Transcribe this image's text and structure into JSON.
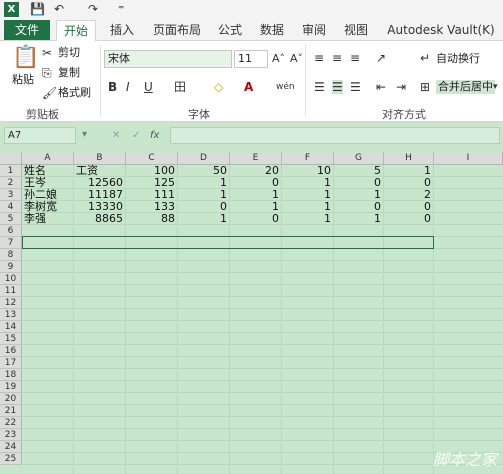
{
  "titlebar": {
    "logo": "X",
    "save": "💾",
    "undo": "↶",
    "redo": "↷",
    "more": "⁼"
  },
  "tabs": [
    "文件",
    "开始",
    "插入",
    "页面布局",
    "公式",
    "数据",
    "审阅",
    "视图",
    "Autodesk Vault(K)"
  ],
  "ribbon": {
    "clipboard": {
      "paste": "粘贴",
      "cut": "剪切",
      "copy": "复制",
      "format_painter": "格式刷",
      "label": "剪贴板"
    },
    "font": {
      "name": "宋体",
      "size": "11",
      "grow": "A˄",
      "shrink": "A˅",
      "bold": "B",
      "italic": "I",
      "underline": "U",
      "border": "田",
      "fill": "◇",
      "color": "A",
      "phonetic": "wén",
      "label": "字体"
    },
    "align": {
      "wrap": "自动换行",
      "merge": "合并后居中",
      "label": "对齐方式"
    }
  },
  "formula_bar": {
    "name_box": "A7",
    "cancel": "✕",
    "enter": "✓",
    "fx": "fx",
    "value": ""
  },
  "columns": [
    "A",
    "B",
    "C",
    "D",
    "E",
    "F",
    "G",
    "H",
    "I"
  ],
  "rows": [
    "1",
    "2",
    "3",
    "4",
    "5",
    "6",
    "7",
    "8",
    "9",
    "10",
    "11",
    "12",
    "13",
    "14",
    "15",
    "16",
    "17",
    "18",
    "19",
    "20",
    "21",
    "22",
    "23",
    "24",
    "25"
  ],
  "cells": [
    [
      "姓名",
      "工资",
      "100",
      "50",
      "20",
      "10",
      "5",
      "1"
    ],
    [
      "王岑",
      "12560",
      "125",
      "1",
      "0",
      "1",
      "0",
      "0"
    ],
    [
      "孙二娘",
      "11187",
      "111",
      "1",
      "1",
      "1",
      "1",
      "2"
    ],
    [
      "李树宽",
      "13330",
      "133",
      "0",
      "1",
      "1",
      "0",
      "0"
    ],
    [
      "李强",
      "8865",
      "88",
      "1",
      "0",
      "1",
      "1",
      "0"
    ]
  ],
  "watermark": "脚本之家"
}
